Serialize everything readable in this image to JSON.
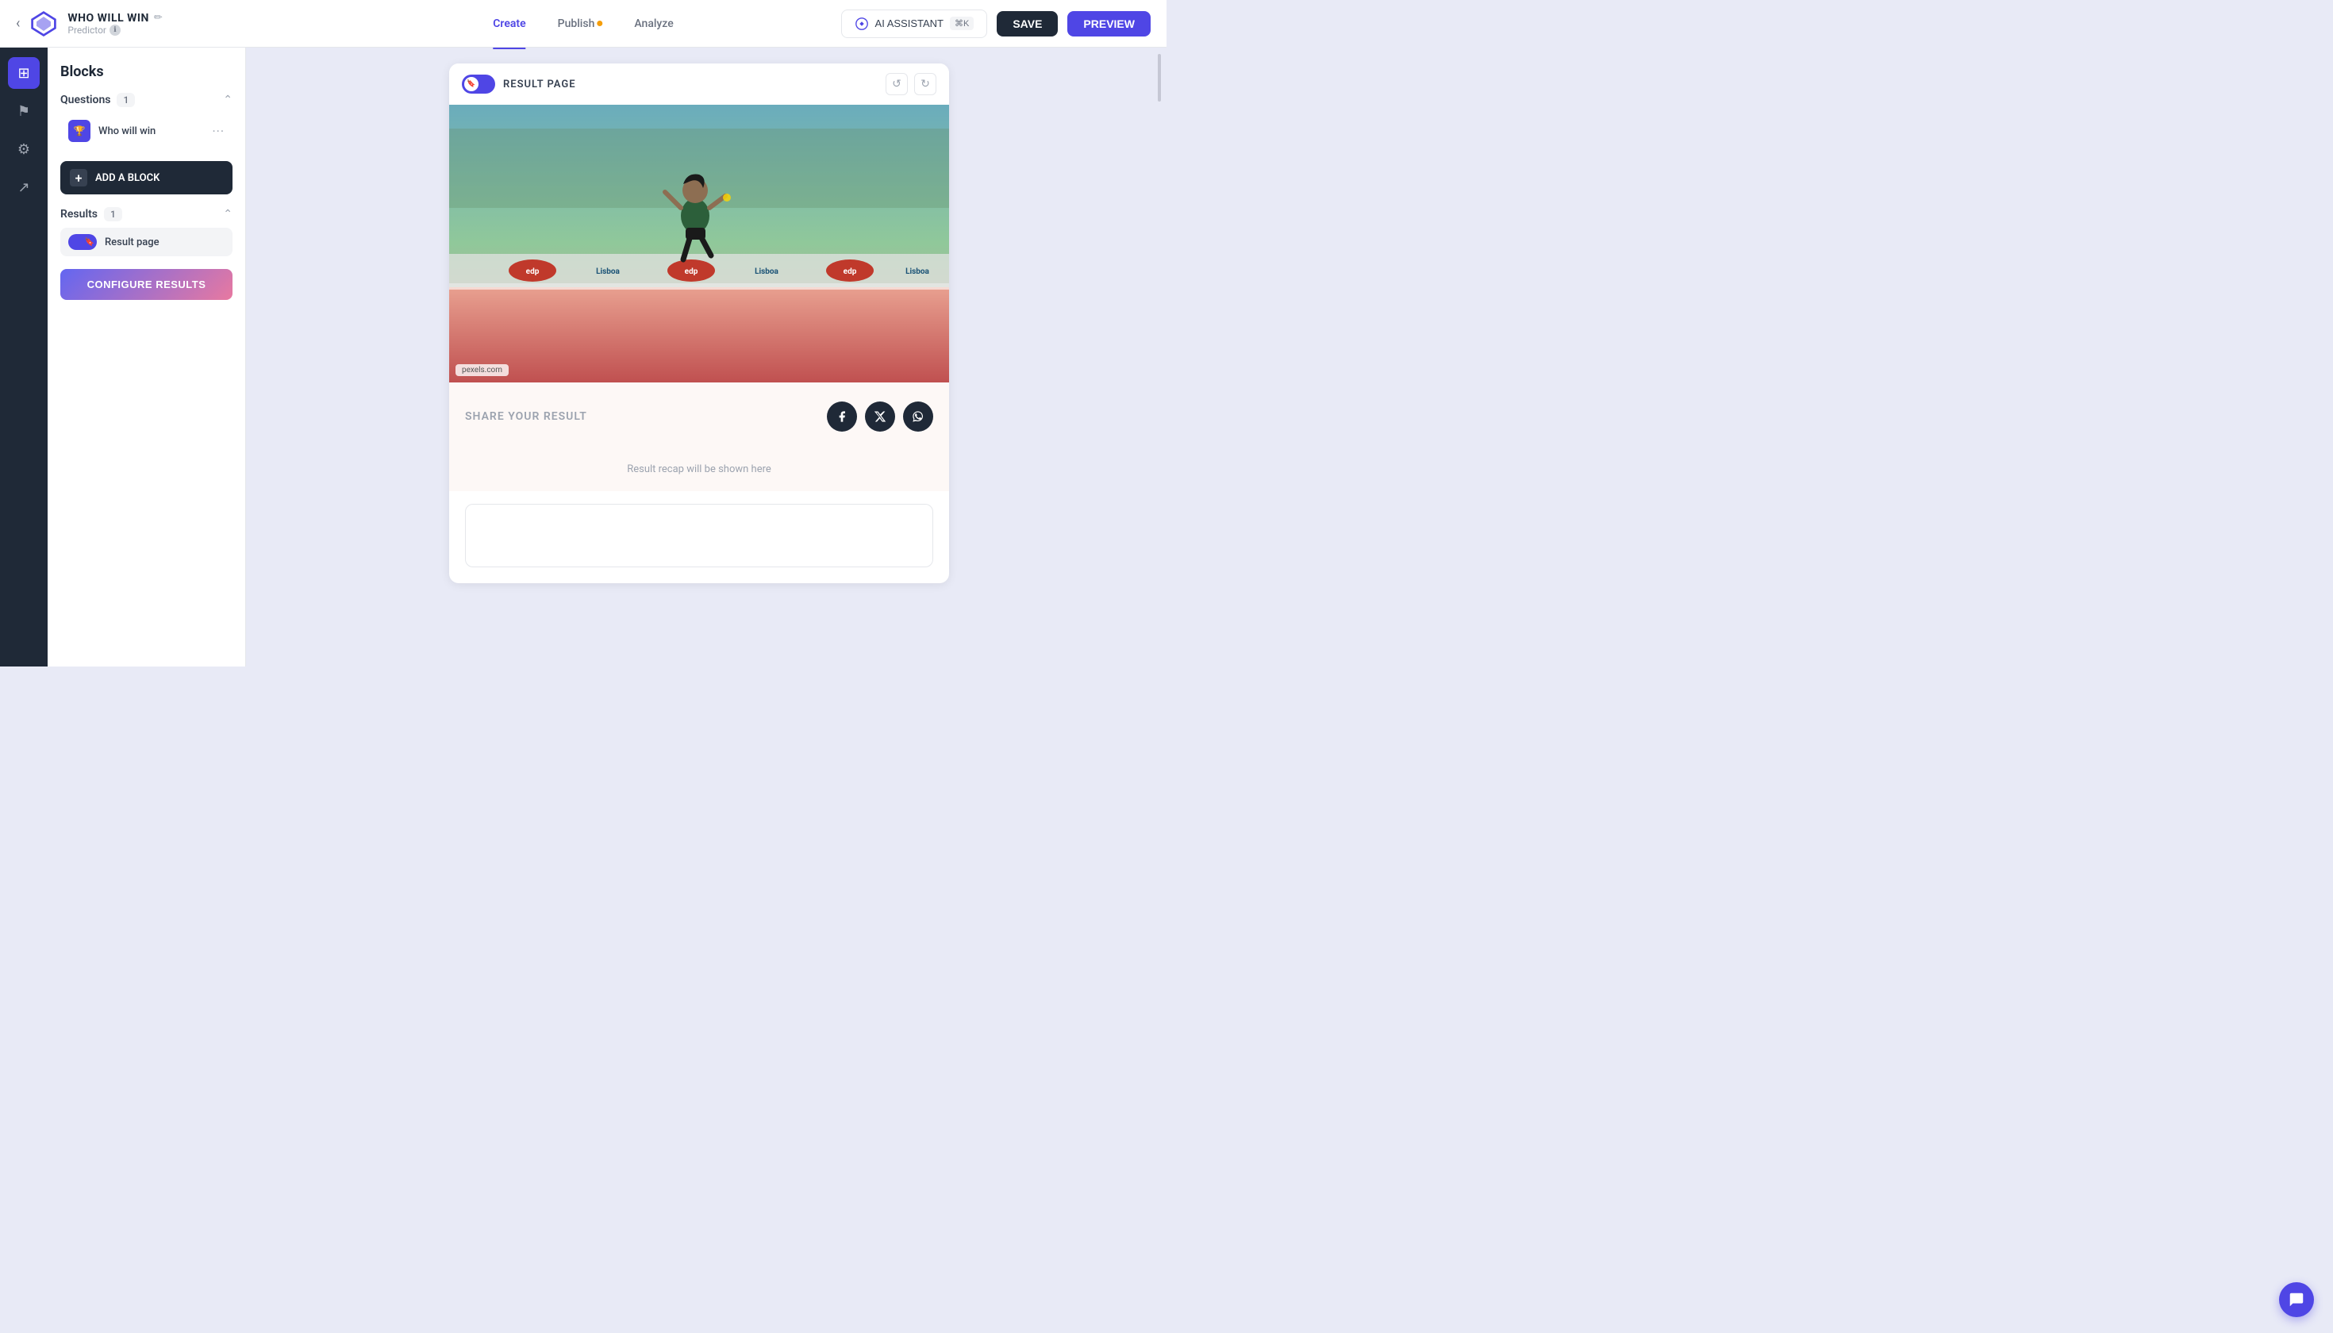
{
  "header": {
    "back_label": "‹",
    "title": "WHO WILL WIN",
    "edit_icon": "✏",
    "subtitle": "Predictor",
    "info": "ℹ",
    "nav": [
      {
        "label": "Create",
        "active": true
      },
      {
        "label": "Publish",
        "badge": true
      },
      {
        "label": "Analyze",
        "active": false
      }
    ],
    "ai_btn_label": "AI ASSISTANT",
    "kbd": "⌘K",
    "save_label": "SAVE",
    "preview_label": "PREVIEW"
  },
  "sidebar_icons": [
    {
      "id": "blocks",
      "icon": "⊞",
      "active": true
    },
    {
      "id": "flag",
      "icon": "⚑",
      "active": false
    },
    {
      "id": "settings",
      "icon": "⚙",
      "active": false
    },
    {
      "id": "share",
      "icon": "↗",
      "active": false
    }
  ],
  "blocks_panel": {
    "title": "Blocks",
    "questions_section": {
      "label": "Questions",
      "count": "1",
      "items": [
        {
          "label": "Who will win",
          "icon": "🏆"
        }
      ]
    },
    "add_block_label": "ADD A BLOCK",
    "results_section": {
      "label": "Results",
      "count": "1",
      "items": [
        {
          "label": "Result page"
        }
      ]
    },
    "configure_btn": "CONFIGURE RESULTS"
  },
  "canvas": {
    "result_page_label": "RESULT PAGE",
    "undo_icon": "↺",
    "redo_icon": "↻",
    "pexels_badge": "pexels.com",
    "share_label": "SHARE YOUR RESULT",
    "share_icons": [
      "f",
      "✕",
      "W"
    ],
    "recap_text": "Result recap will be shown here"
  },
  "chat_icon": "💬"
}
